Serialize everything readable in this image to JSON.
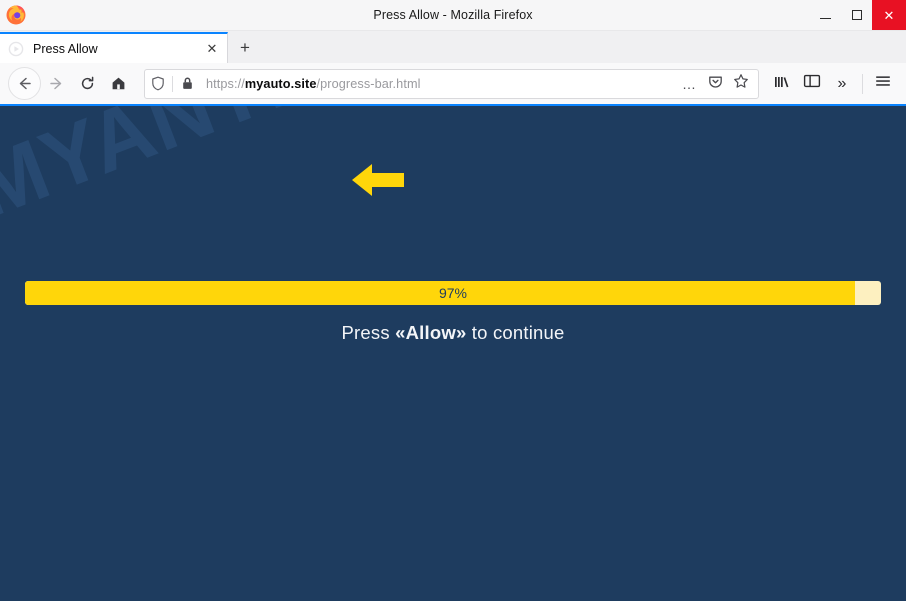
{
  "window": {
    "title": "Press Allow - Mozilla Firefox",
    "logo_icon": "firefox-logo",
    "controls": {
      "minimize_label": "—",
      "minimize_icon": "minimize-icon",
      "maximize_label": "□",
      "maximize_icon": "maximize-icon",
      "close_label": "✕",
      "close_icon": "close-icon",
      "close_color": "#e81123"
    }
  },
  "tabs": {
    "items": [
      {
        "title": "Press Allow",
        "favicon_icon": "play-circle-favicon",
        "close_label": "✕",
        "close_icon": "tab-close-icon",
        "active": true
      }
    ],
    "new_tab_label": "+",
    "new_tab_icon": "plus-icon",
    "active_tab_accent": "#0a84ff"
  },
  "toolbar": {
    "back_icon": "arrow-left-icon",
    "forward_icon": "arrow-right-icon",
    "reload_icon": "reload-icon",
    "home_icon": "home-icon",
    "library_icon": "library-icon",
    "sidebar_icon": "sidebar-icon",
    "overflow_label": "»",
    "overflow_icon": "chevron-double-right-icon",
    "menu_icon": "hamburger-menu-icon"
  },
  "urlbar": {
    "tracking_protection_icon": "shield-icon",
    "lock_icon": "padlock-icon",
    "scheme": "https://",
    "host": "myauto.site",
    "path": "/progress-bar.html",
    "full_url": "https://myauto.site/progress-bar.html",
    "page_actions_label": "…",
    "page_actions_icon": "ellipsis-icon",
    "pocket_icon": "pocket-icon",
    "bookmark_icon": "star-icon"
  },
  "page": {
    "background_color": "#1e3c5f",
    "watermark_text": "MYANTISPYWARE.COM",
    "arrow_icon": "arrow-left-yellow-icon",
    "arrow_color": "#ffd60a",
    "progress": {
      "percent_label": "97%",
      "percent_value": 97,
      "fill_color": "#ffd60a",
      "track_color": "#fdf0c0"
    },
    "instruction_prefix": "Press ",
    "instruction_emphasis": "«Allow»",
    "instruction_suffix": " to continue"
  }
}
